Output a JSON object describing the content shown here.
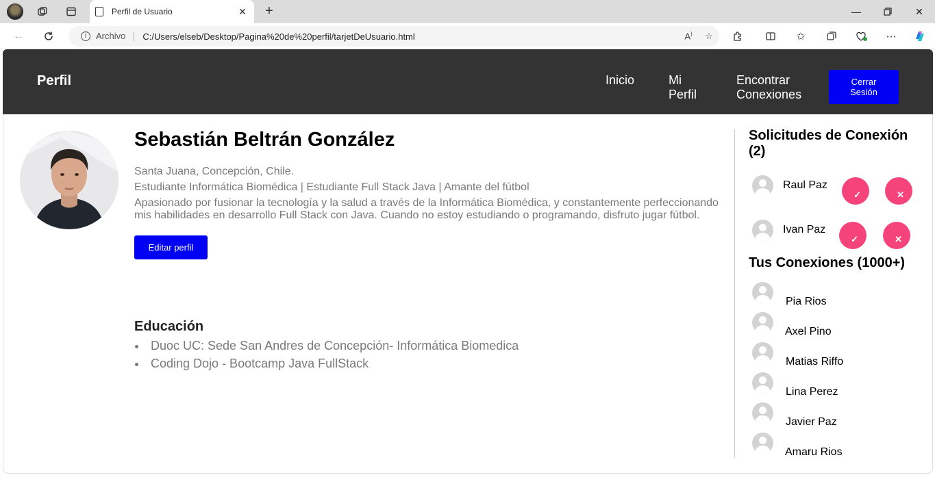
{
  "browser": {
    "tab_title": "Perfil de Usuario",
    "address_scheme": "Archivo",
    "address_url": "C:/Users/elseb/Desktop/Pagina%20de%20perfil/tarjetDeUsuario.html"
  },
  "header": {
    "brand": "Perfil",
    "nav": {
      "inicio": "Inicio",
      "mi_perfil_1": "Mi",
      "mi_perfil_2": "Perfil",
      "encontrar_1": "Encontrar",
      "encontrar_2": "Conexiones"
    },
    "logout_1": "Cerrar",
    "logout_2": "Sesión"
  },
  "profile": {
    "name": "Sebastián Beltrán González",
    "location": "Santa Juana, Concepción, Chile.",
    "headline": "Estudiante Informática Biomédica | Estudiante Full Stack Java | Amante del fútbol",
    "bio_1": "Apasionado por fusionar la tecnología y la salud a través de la Informática Biomédica, y constantemente perfeccionando",
    "bio_2": "mis habilidades en desarrollo Full Stack con Java. Cuando no estoy estudiando o programando, disfruto jugar fútbol.",
    "edit_label": "Editar perfil",
    "education_title": "Educación",
    "education": [
      "Duoc UC: Sede San Andres de Concepción- Informática Biomedica",
      "Coding Dojo - Bootcamp Java FullStack"
    ]
  },
  "requests": {
    "title_1": "Solicitudes de Conexión",
    "title_2": "(2)",
    "items": [
      {
        "name": "Raul Paz",
        "accept": "✓",
        "reject": "✕"
      },
      {
        "name": "Ivan Paz",
        "accept": "✓",
        "reject": "✕"
      }
    ]
  },
  "connections": {
    "title": "Tus Conexiones (1000+)",
    "items": [
      "Pia Rios",
      "Axel Pino",
      "Matias Riffo",
      "Lina Perez",
      "Javier Paz",
      "Amaru Rios"
    ]
  },
  "colors": {
    "header_bg": "#333333",
    "primary_button": "#0000f5",
    "request_button": "#f5437c"
  }
}
